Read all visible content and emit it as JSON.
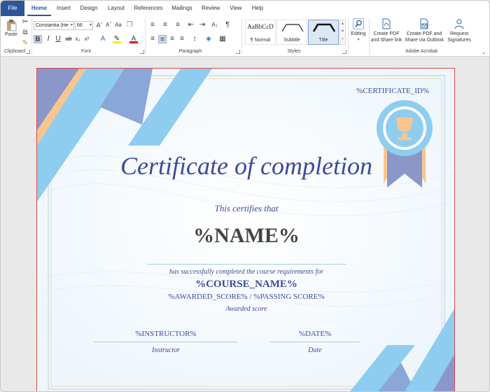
{
  "tabs": [
    "File",
    "Home",
    "Insert",
    "Design",
    "Layout",
    "References",
    "Mailings",
    "Review",
    "View",
    "Help"
  ],
  "active_tab": "Home",
  "ribbon": {
    "clipboard": {
      "label": "Clipboard",
      "paste_label": "Paste"
    },
    "font": {
      "label": "Font",
      "font_name": "Constantia (He",
      "font_size": "66"
    },
    "paragraph": {
      "label": "Paragraph"
    },
    "styles": {
      "label": "Styles",
      "items": [
        {
          "name": "¶ Normal",
          "preview": "AaBbCcD"
        },
        {
          "name": "Subtitle",
          "preview": ""
        },
        {
          "name": "Title",
          "preview": ""
        }
      ]
    },
    "editing": {
      "label": "Editing"
    },
    "acrobat": {
      "label": "Adobe Acrobat",
      "buttons": [
        {
          "line1": "Create PDF",
          "line2": "and Share link"
        },
        {
          "line1": "Create PDF and",
          "line2": "Share via Outlook"
        },
        {
          "line1": "Request",
          "line2": "Signatures"
        }
      ]
    }
  },
  "certificate": {
    "id": "%CERTIFICATE_ID%",
    "title": "Certificate of completion",
    "certifies": "This certifies that",
    "name": "%NAME%",
    "completed": "has successfully completed the course requirements for",
    "course": "%COURSE_NAME%",
    "score": "%AWARDED_SCORE% / %PASSING SCORE%",
    "awarded_label": "Awarded score",
    "instructor_value": "%INSTRUCTOR%",
    "instructor_label": "Instructor",
    "date_value": "%DATE%",
    "date_label": "Date"
  },
  "colors": {
    "accent": "#2b579a",
    "title_blue": "#3b4a9a",
    "ribbon_light": "#8ecdf0",
    "ribbon_purple": "#8b96c9",
    "ribbon_orange": "#f7c68e",
    "page_border": "#d94a4a"
  }
}
